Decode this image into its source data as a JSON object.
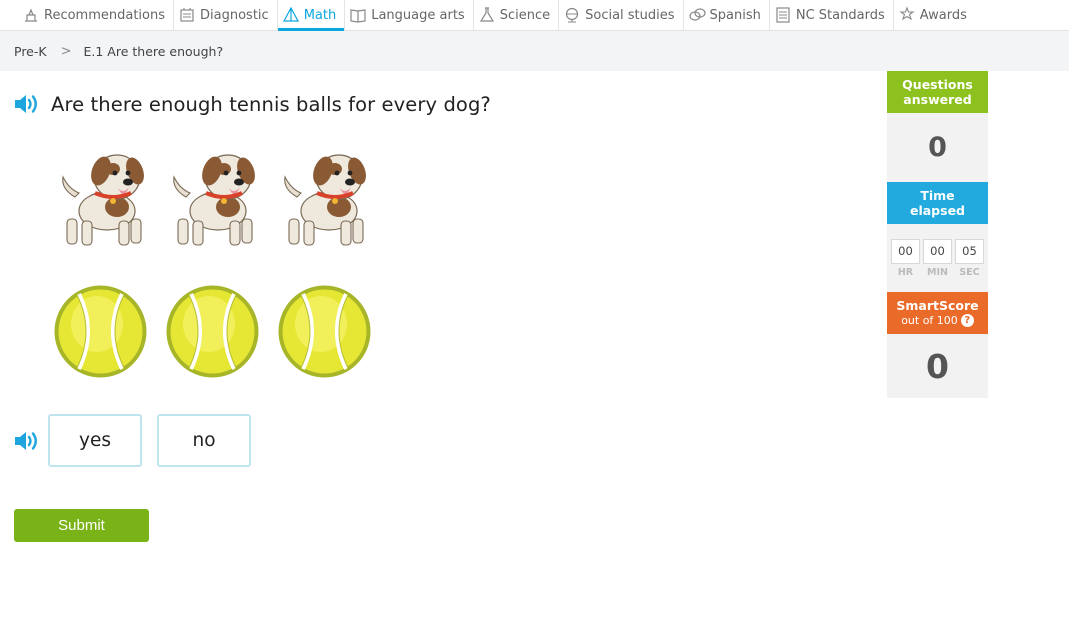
{
  "nav": {
    "items": [
      {
        "label": "Recommendations",
        "icon": "recommendations-icon"
      },
      {
        "label": "Diagnostic",
        "icon": "diagnostic-icon"
      },
      {
        "label": "Math",
        "icon": "math-icon",
        "active": true
      },
      {
        "label": "Language arts",
        "icon": "language-arts-icon"
      },
      {
        "label": "Science",
        "icon": "science-icon"
      },
      {
        "label": "Social studies",
        "icon": "social-studies-icon"
      },
      {
        "label": "Spanish",
        "icon": "spanish-icon"
      },
      {
        "label": "NC Standards",
        "icon": "standards-icon"
      },
      {
        "label": "Awards",
        "icon": "awards-icon"
      }
    ],
    "active_color": "#0aa6dd"
  },
  "breadcrumb": {
    "level": "Pre-K",
    "separator": ">",
    "skill": "E.1 Are there enough?"
  },
  "question": {
    "text": "Are there enough tennis balls for every dog?",
    "dogs_count": 3,
    "balls_count": 3
  },
  "answers": {
    "choices": [
      "yes",
      "no"
    ]
  },
  "submit_label": "Submit",
  "sidebar": {
    "questions_label_1": "Questions",
    "questions_label_2": "answered",
    "questions_value": "0",
    "time_label_1": "Time",
    "time_label_2": "elapsed",
    "timer": {
      "hr": "00",
      "min": "00",
      "sec": "05"
    },
    "timer_labels": {
      "hr": "HR",
      "min": "MIN",
      "sec": "SEC"
    },
    "smartscore_label": "SmartScore",
    "smartscore_sub": "out of 100",
    "smartscore_help": "?",
    "smartscore_value": "0"
  },
  "colors": {
    "green": "#8cc11e",
    "blue": "#22aadf",
    "orange": "#ea6a29",
    "submit": "#7ab317"
  }
}
